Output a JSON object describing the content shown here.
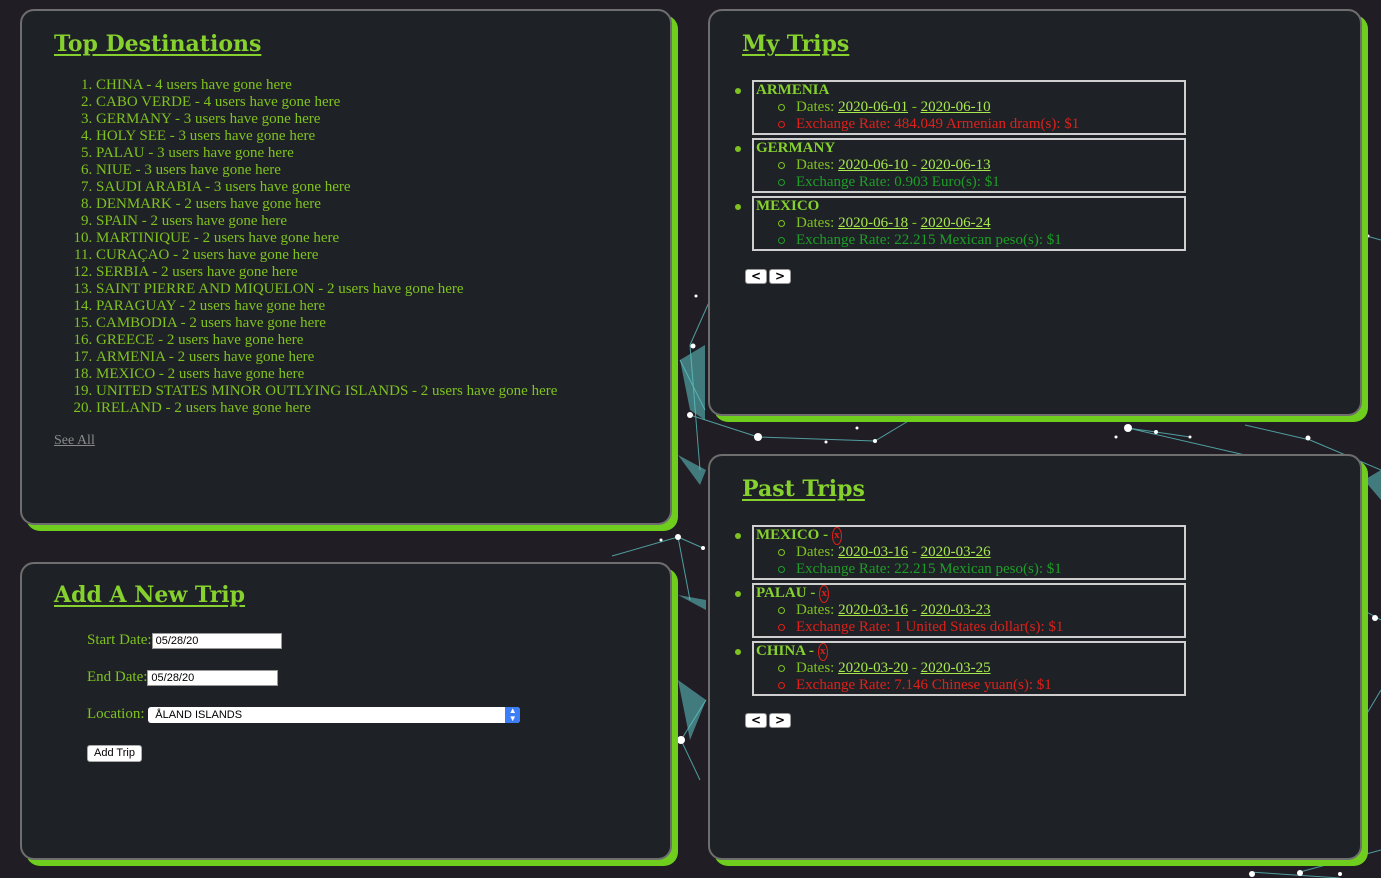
{
  "top_destinations": {
    "title": "Top Destinations",
    "items": [
      "CHINA - 4 users have gone here",
      "CABO VERDE - 4 users have gone here",
      "GERMANY - 3 users have gone here",
      "HOLY SEE - 3 users have gone here",
      "PALAU - 3 users have gone here",
      "NIUE - 3 users have gone here",
      "SAUDI ARABIA - 3 users have gone here",
      "DENMARK - 2 users have gone here",
      "SPAIN - 2 users have gone here",
      "MARTINIQUE - 2 users have gone here",
      "CURAÇAO - 2 users have gone here",
      "SERBIA - 2 users have gone here",
      "SAINT PIERRE AND MIQUELON - 2 users have gone here",
      "PARAGUAY - 2 users have gone here",
      "CAMBODIA - 2 users have gone here",
      "GREECE - 2 users have gone here",
      "ARMENIA - 2 users have gone here",
      "MEXICO - 2 users have gone here",
      "UNITED STATES MINOR OUTLYING ISLANDS - 2 users have gone here",
      "IRELAND - 2 users have gone here"
    ],
    "see_all_label": "See All"
  },
  "add_trip": {
    "title": "Add A New Trip",
    "start_label": "Start Date:",
    "start_value": "05/28/20",
    "end_label": "End Date:",
    "end_value": "05/28/20",
    "location_label": "Location:",
    "location_value": "ÅLAND ISLANDS",
    "submit_label": "Add Trip"
  },
  "my_trips": {
    "title": "My Trips",
    "dates_label": "Dates:",
    "separator": "-",
    "trips": [
      {
        "country": "ARMENIA",
        "start": "2020-06-01",
        "end": "2020-06-10",
        "rate": "Exchange Rate: 484.049 Armenian dram(s): $1",
        "rate_color": "red"
      },
      {
        "country": "GERMANY",
        "start": "2020-06-10",
        "end": "2020-06-13",
        "rate": "Exchange Rate: 0.903 Euro(s): $1",
        "rate_color": "green"
      },
      {
        "country": "MEXICO",
        "start": "2020-06-18",
        "end": "2020-06-24",
        "rate": "Exchange Rate: 22.215 Mexican peso(s): $1",
        "rate_color": "green"
      }
    ]
  },
  "past_trips": {
    "title": "Past Trips",
    "dates_label": "Dates:",
    "separator": "-",
    "remove_symbol": "x",
    "trips": [
      {
        "country": "MEXICO",
        "start": "2020-03-16",
        "end": "2020-03-26",
        "rate": "Exchange Rate: 22.215 Mexican peso(s): $1",
        "rate_color": "green"
      },
      {
        "country": "PALAU",
        "start": "2020-03-16",
        "end": "2020-03-23",
        "rate": "Exchange Rate: 1 United States dollar(s): $1",
        "rate_color": "red"
      },
      {
        "country": "CHINA",
        "start": "2020-03-20",
        "end": "2020-03-25",
        "rate": "Exchange Rate: 7.146 Chinese yuan(s): $1",
        "rate_color": "red"
      }
    ]
  },
  "pager": {
    "prev_icon": "chevron-left-icon",
    "next_icon": "chevron-right-icon"
  },
  "colors": {
    "accent": "#7dc520",
    "panel": "#1e2226",
    "background": "#211d24",
    "network": "#5ec8c8"
  }
}
